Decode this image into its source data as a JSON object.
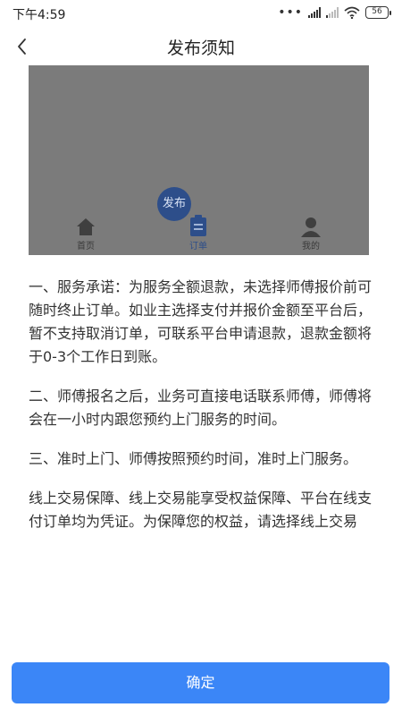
{
  "status_bar": {
    "time": "下午4:59",
    "battery": "56"
  },
  "header": {
    "title": "发布须知",
    "back_icon": "chevron-left-icon"
  },
  "preview": {
    "fab_label": "发布",
    "tabs": [
      {
        "label": "首页",
        "icon": "home-icon"
      },
      {
        "label": "订单",
        "icon": "clipboard-icon"
      },
      {
        "label": "我的",
        "icon": "user-icon"
      }
    ]
  },
  "notice": {
    "paragraphs": [
      "一、服务承诺：为服务全额退款，未选择师傅报价前可随时终止订单。如业主选择支付并报价金额至平台后，暂不支持取消订单，可联系平台申请退款，退款金额将于0-3个工作日到账。",
      "二、师傅报名之后，业务可直接电话联系师傅，师傅将会在一小时内跟您预约上门服务的时间。",
      "三、准时上门、师傅按照预约时间，准时上门服务。",
      "线上交易保障、线上交易能享受权益保障、平台在线支付订单均为凭证。为保障您的权益，请选择线上交易"
    ]
  },
  "footer": {
    "confirm_label": "确定"
  },
  "colors": {
    "accent": "#3b86f7",
    "preview_bg": "#7b7b7b",
    "fab": "#2d4e8a"
  }
}
